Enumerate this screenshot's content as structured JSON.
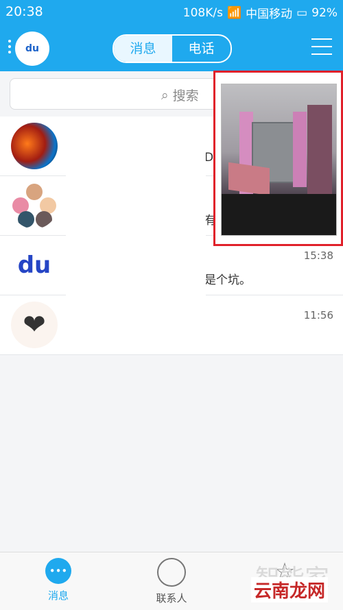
{
  "status": {
    "time": "20:38",
    "speed": "108K/s",
    "carrier": "中国移动",
    "battery": "92%"
  },
  "header": {
    "tabs": [
      {
        "label": "消息"
      },
      {
        "label": "电话"
      }
    ],
    "logo": "du"
  },
  "search": {
    "placeholder": "搜索"
  },
  "conversations": [
    {
      "snippet": "DT",
      "time": ""
    },
    {
      "snippet": "有人",
      "time": ""
    },
    {
      "snippet": "是个坑。",
      "time": "15:38"
    },
    {
      "snippet": "",
      "time": "11:56"
    }
  ],
  "tabs": [
    {
      "label": "消息"
    },
    {
      "label": "联系人"
    },
    {
      "label": ""
    }
  ],
  "watermark": {
    "text": "智能家"
  },
  "brand": {
    "text": "云南龙网"
  },
  "colors": {
    "accent": "#1fa9ee",
    "highlight": "#e0202a"
  }
}
